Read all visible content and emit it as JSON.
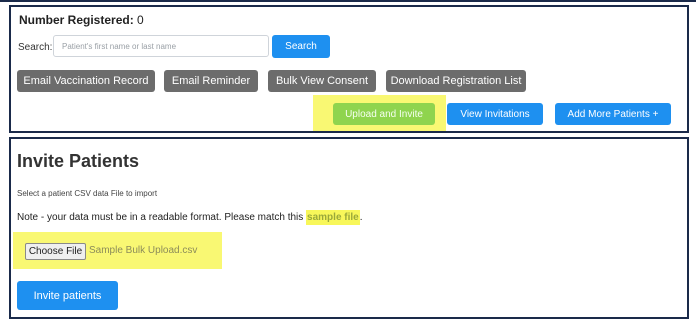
{
  "registration": {
    "label": "Number Registered:",
    "count": "0"
  },
  "search": {
    "label": "Search:",
    "placeholder": "Patient's first name or last name",
    "button": "Search"
  },
  "actions_row": [
    "Email Vaccination Record",
    "Email Reminder",
    "Bulk View Consent",
    "Download Registration List"
  ],
  "actions_right": {
    "upload": "Upload and Invite",
    "view_invitations": "View Invitations",
    "add_more": "Add More Patients +"
  },
  "invite": {
    "title": "Invite Patients",
    "select_text": "Select a patient CSV data File to import",
    "note_prefix": "Note - your data must be in a readable format. Please match this ",
    "note_link": "sample file",
    "note_suffix": ".",
    "choose_file": "Choose File",
    "file_name": "Sample Bulk Upload.csv",
    "invite_button": "Invite patients"
  },
  "colors": {
    "primary": "#1e90f0",
    "secondary": "#6c6c6c",
    "highlight": "#f8f75a",
    "border": "#1a2a4a"
  }
}
